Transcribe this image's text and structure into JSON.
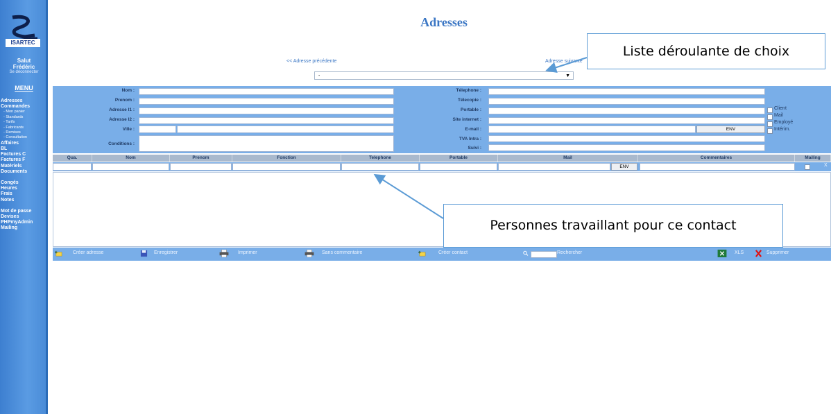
{
  "sidebar": {
    "logo_text": "ISARTEC",
    "greeting": "Salut",
    "user": "Frédéric",
    "logout": "Se déconnecter",
    "menu_title": "MENU",
    "items": [
      {
        "label": "Adresses",
        "sub": false
      },
      {
        "label": "Commandes",
        "sub": false
      },
      {
        "label": "- Mon panier",
        "sub": true
      },
      {
        "label": "- Standards",
        "sub": true
      },
      {
        "label": "- Tarifs",
        "sub": true
      },
      {
        "label": "- Fabricants",
        "sub": true
      },
      {
        "label": "- Remises",
        "sub": true
      },
      {
        "label": "- Consultation",
        "sub": true
      },
      {
        "label": "Affaires",
        "sub": false
      },
      {
        "label": "BL",
        "sub": false
      },
      {
        "label": "Factures C",
        "sub": false
      },
      {
        "label": "Factures F",
        "sub": false
      },
      {
        "label": "Matériels",
        "sub": false
      },
      {
        "label": "Documents",
        "sub": false
      },
      {
        "label": "",
        "gap": true
      },
      {
        "label": "Congés",
        "sub": false
      },
      {
        "label": "Heures",
        "sub": false
      },
      {
        "label": "Frais",
        "sub": false
      },
      {
        "label": "Notes",
        "sub": false
      },
      {
        "label": "",
        "gap": true
      },
      {
        "label": "Mot de passe",
        "sub": false
      },
      {
        "label": "Devises",
        "sub": false
      },
      {
        "label": "PHPmyAdmin",
        "sub": false
      },
      {
        "label": "Mailing",
        "sub": false
      }
    ]
  },
  "header": {
    "title": "Adresses",
    "prev": "<< Adresse précédente",
    "next": "Adresse suivante",
    "select_value": "-"
  },
  "form": {
    "left_labels": [
      "Nom :",
      "Prenom :",
      "Adresse l1 :",
      "Adresse l2 :",
      "Ville :",
      "Conditions :"
    ],
    "right_labels": [
      "Télephone :",
      "Télecopie :",
      "Portable :",
      "Site internet :",
      "E-mail :",
      "TVA Intra :",
      "Suivi :"
    ],
    "env_label": "ENV",
    "checkboxes": [
      "Client",
      "Mail",
      "Employé",
      "Intérim."
    ]
  },
  "contacts_table": {
    "headers": [
      "Qua.",
      "Nom",
      "Prenom",
      "Fonction",
      "Telephone",
      "Portable",
      "Mail",
      "Commentaires",
      "Mailing"
    ],
    "env_label": "ENV",
    "delete_label": "X"
  },
  "toolbar": {
    "create_address": "Créer adresse",
    "save": "Enregistrer",
    "print": "Imprimer",
    "print_no_comment": "Sans commentaire",
    "create_contact": "Créer contact",
    "search": "Rechercher",
    "xls": "XLS",
    "delete": "Supprimer"
  },
  "annotations": {
    "dropdown_note": "Liste déroulante de choix",
    "contacts_note": "Personnes travaillant pour ce contact"
  },
  "colors": {
    "sidebar": "#4a8cd8",
    "form_bg": "#79aee8",
    "accent": "#3a76c4"
  }
}
